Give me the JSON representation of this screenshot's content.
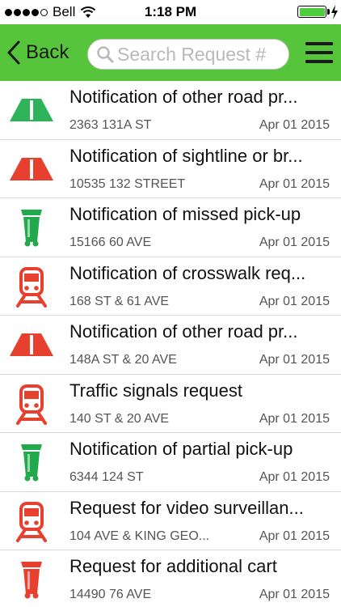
{
  "status_bar": {
    "carrier": "Bell",
    "time": "1:18 PM",
    "battery_fraction": 1.0,
    "signal_bars_filled": 4,
    "signal_bars_total": 5
  },
  "nav": {
    "back_label": "Back",
    "search_placeholder": "Search Request #",
    "search_value": ""
  },
  "colors": {
    "nav_green": "#56c53b",
    "road_green": "#2fb35a",
    "road_red": "#e8402f",
    "cart_green": "#22a94b",
    "train_red": "#e8402f"
  },
  "requests": [
    {
      "icon": "road-green-icon",
      "title": "Notification of other road pr...",
      "address": "2363 131A ST",
      "date": "Apr 01 2015"
    },
    {
      "icon": "road-red-icon",
      "title": "Notification of sightline or br...",
      "address": "10535 132 STREET",
      "date": "Apr 01 2015"
    },
    {
      "icon": "garbage-cart-green-icon",
      "title": "Notification of missed pick-up",
      "address": "15166 60 AVE",
      "date": "Apr 01 2015"
    },
    {
      "icon": "train-red-icon",
      "title": "Notification of crosswalk req...",
      "address": "168 ST & 61 AVE",
      "date": "Apr 01 2015"
    },
    {
      "icon": "road-red-icon",
      "title": "Notification of other road pr...",
      "address": "148A ST & 20 AVE",
      "date": "Apr 01 2015"
    },
    {
      "icon": "train-red-icon",
      "title": "Traffic signals request",
      "address": "140 ST & 20 AVE",
      "date": "Apr 01 2015"
    },
    {
      "icon": "garbage-cart-green-icon",
      "title": "Notification of partial pick-up",
      "address": "6344 124 ST",
      "date": "Apr 01 2015"
    },
    {
      "icon": "train-red-icon",
      "title": "Request for video surveillan...",
      "address": "104 AVE & KING GEO...",
      "date": "Apr 01 2015"
    },
    {
      "icon": "garbage-cart-red-icon",
      "title": "Request for additional cart",
      "address": "14490 76 AVE",
      "date": "Apr 01 2015"
    }
  ]
}
